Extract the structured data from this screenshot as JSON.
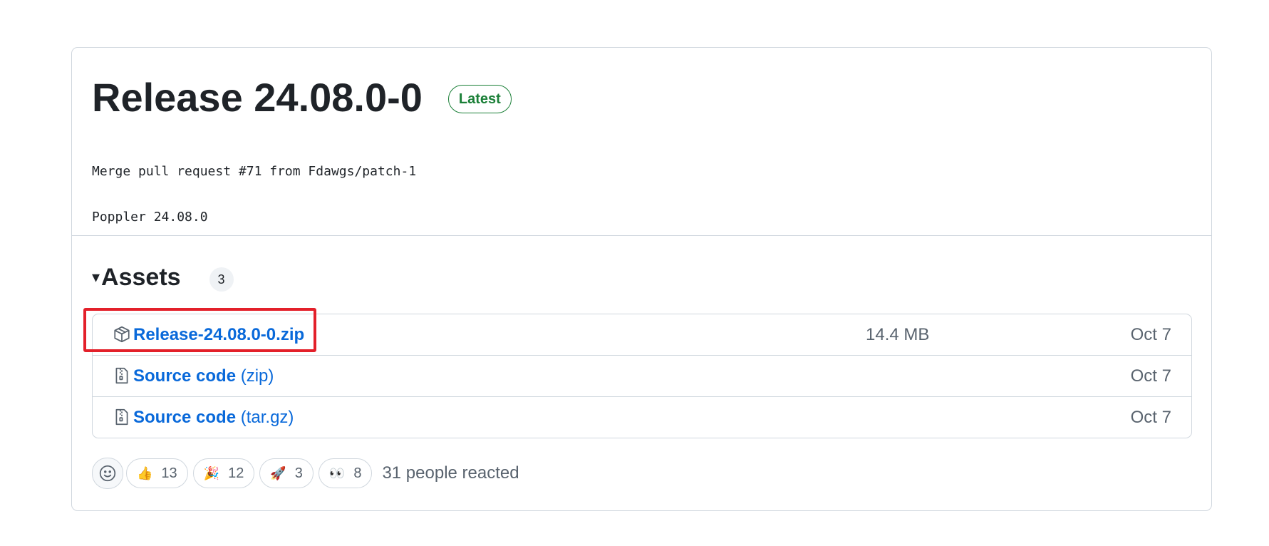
{
  "release": {
    "title": "Release 24.08.0-0",
    "badge": "Latest",
    "body_lines": [
      "Merge pull request #71 from Fdawgs/patch-1",
      "Poppler 24.08.0"
    ]
  },
  "assets": {
    "caret": "▾",
    "title": "Assets",
    "count": "3",
    "items": [
      {
        "name": "Release-24.08.0-0.zip",
        "ext": "",
        "size": "14.4 MB",
        "date": "Oct 7",
        "icon": "package-icon"
      },
      {
        "name": "Source code",
        "ext": "(zip)",
        "size": "",
        "date": "Oct 7",
        "icon": "file-zip-icon"
      },
      {
        "name": "Source code",
        "ext": "(tar.gz)",
        "size": "",
        "date": "Oct 7",
        "icon": "file-zip-icon"
      }
    ]
  },
  "reactions": {
    "items": [
      {
        "emoji": "👍",
        "count": "13"
      },
      {
        "emoji": "🎉",
        "count": "12"
      },
      {
        "emoji": "🚀",
        "count": "3"
      },
      {
        "emoji": "👀",
        "count": "8"
      }
    ],
    "summary": "31 people reacted"
  },
  "colors": {
    "link": "#0969da",
    "badge_green": "#1a7f37",
    "highlight": "#e3202a",
    "muted": "#59636e"
  }
}
